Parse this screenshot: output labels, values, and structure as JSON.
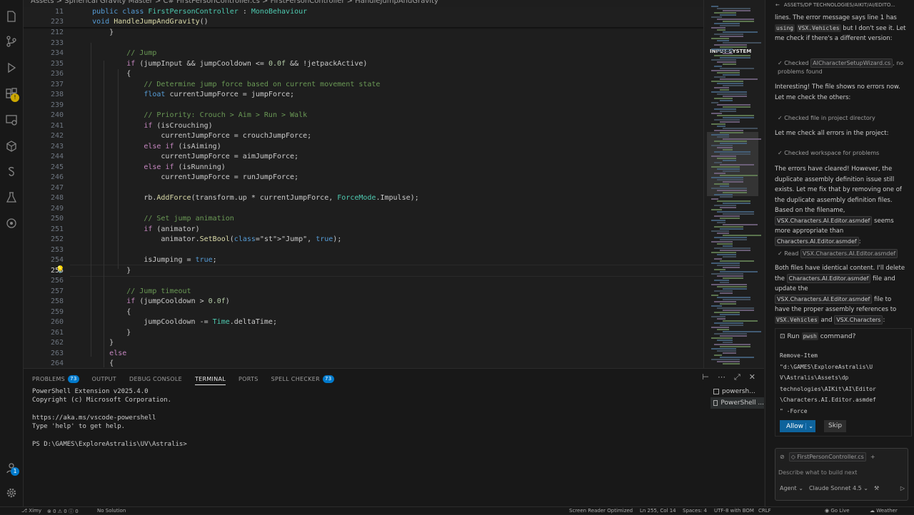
{
  "breadcrumb": "Assets > Spherical Gravity Master > C# FirstPersonController.cs > FirstPersonController > HandleJumpAndGravity",
  "sticky_lines": [
    {
      "num": "11",
      "text": "    public class FirstPersonController : MonoBehaviour"
    },
    {
      "num": "223",
      "text": "    void HandleJumpAndGravity()"
    }
  ],
  "code_lines": [
    {
      "num": "212",
      "text": "        }"
    },
    {
      "num": "233",
      "text": ""
    },
    {
      "num": "234",
      "text": "            // Jump"
    },
    {
      "num": "235",
      "text": "            if (jumpInput && jumpCooldown <= 0.0f && !jetpackActive)"
    },
    {
      "num": "236",
      "text": "            {"
    },
    {
      "num": "237",
      "text": "                // Determine jump force based on current movement state"
    },
    {
      "num": "238",
      "text": "                float currentJumpForce = jumpForce;"
    },
    {
      "num": "239",
      "text": ""
    },
    {
      "num": "240",
      "text": "                // Priority: Crouch > Aim > Run > Walk"
    },
    {
      "num": "241",
      "text": "                if (isCrouching)"
    },
    {
      "num": "242",
      "text": "                    currentJumpForce = crouchJumpForce;"
    },
    {
      "num": "243",
      "text": "                else if (isAiming)"
    },
    {
      "num": "244",
      "text": "                    currentJumpForce = aimJumpForce;"
    },
    {
      "num": "245",
      "text": "                else if (isRunning)"
    },
    {
      "num": "246",
      "text": "                    currentJumpForce = runJumpForce;"
    },
    {
      "num": "247",
      "text": ""
    },
    {
      "num": "248",
      "text": "                rb.AddForce(transform.up * currentJumpForce, ForceMode.Impulse);"
    },
    {
      "num": "249",
      "text": ""
    },
    {
      "num": "250",
      "text": "                // Set jump animation"
    },
    {
      "num": "251",
      "text": "                if (animator)"
    },
    {
      "num": "252",
      "text": "                    animator.SetBool(\"Jump\", true);"
    },
    {
      "num": "253",
      "text": ""
    },
    {
      "num": "254",
      "text": "                isJumping = true;"
    },
    {
      "num": "255",
      "text": "            }"
    },
    {
      "num": "256",
      "text": ""
    },
    {
      "num": "257",
      "text": "            // Jump timeout"
    },
    {
      "num": "258",
      "text": "            if (jumpCooldown > 0.0f)"
    },
    {
      "num": "259",
      "text": "            {"
    },
    {
      "num": "260",
      "text": "                jumpCooldown -= Time.deltaTime;"
    },
    {
      "num": "261",
      "text": "            }"
    },
    {
      "num": "262",
      "text": "        }"
    },
    {
      "num": "263",
      "text": "        else"
    },
    {
      "num": "264",
      "text": "        {"
    }
  ],
  "minimap": {
    "label": "INPUT SYSTEM"
  },
  "panel": {
    "tabs": [
      {
        "label": "PROBLEMS",
        "count": "73"
      },
      {
        "label": "OUTPUT",
        "count": ""
      },
      {
        "label": "DEBUG CONSOLE",
        "count": ""
      },
      {
        "label": "TERMINAL",
        "count": ""
      },
      {
        "label": "PORTS",
        "count": ""
      },
      {
        "label": "SPELL CHECKER",
        "count": "73"
      }
    ],
    "active_tab": "TERMINAL",
    "terminal_lines": [
      "PowerShell Extension v2025.4.0",
      "Copyright (c) Microsoft Corporation.",
      "",
      "https://aka.ms/vscode-powershell",
      "Type 'help' to get help.",
      "",
      "PS D:\\GAMES\\ExploreAstralis\\UV\\Astralis>"
    ],
    "terminals": [
      "powersh...",
      "PowerShell ..."
    ]
  },
  "chat": {
    "header": "ASSETS/DP TECHNOLOGIES/AIKIT/AI/EDITO...",
    "p1_text": "lines. The error message says line 1 has",
    "p1_code": "using",
    "p1_code2": "VSX.Vehicles",
    "p1_rest": "but I don't see it. Let me check if there's a different version:",
    "check1_prefix": "Checked",
    "check1_file": "AICharacterSetupWizard.cs",
    "check1_suffix": ", no problems found",
    "p2": "Interesting! The file shows no errors now. Let me check the others:",
    "check2": "Checked file in project directory",
    "p3": "Let me check all errors in the project:",
    "check3": "Checked workspace for problems",
    "p4": "The errors have cleared! However, the duplicate assembly definition issue still exists. Let me fix that by removing one of the duplicate assembly definition files. Based on the filename,",
    "p4_file1": "VSX.Characters.AI.Editor.asmdef",
    "p4_mid": "seems more appropriate than",
    "p4_file2": "Characters.AI.Editor.asmdef",
    "check4_prefix": "Read",
    "check4_file": "VSX.Characters.AI.Editor.asmdef",
    "p5_a": "Both files have identical content. I'll delete the",
    "p5_file1": "Characters.AI.Editor.asmdef",
    "p5_b": "file and update the",
    "p5_file2": "VSX.Characters.AI.Editor.asmdef",
    "p5_c": "file to have the proper assembly references to",
    "p5_code1": "VSX.Vehicles",
    "p5_and": "and",
    "p5_code2": "VSX.Characters",
    "run_label": "Run",
    "run_shell": "pwsh",
    "run_suffix": "command?",
    "run_command": "Remove-Item\n\"d:\\GAMES\\ExploreAstralis\\U\nV\\Astralis\\Assets\\dp\ntechnologies\\AIKit\\AI\\Editor\n\\Characters.AI.Editor.asmdef\n\" -Force",
    "allow_label": "Allow",
    "skip_label": "Skip",
    "context_file": "FirstPersonController.cs",
    "input_placeholder": "Describe what to build next",
    "mode": "Agent",
    "model": "Claude Sonnet 4.5"
  },
  "status": {
    "branch": "Ximy",
    "errors": "0",
    "warnings": "0",
    "info": "0",
    "solution": "No Solution",
    "screen_reader": "Screen Reader Optimized",
    "position": "Ln 255, Col 14",
    "spaces": "Spaces: 4",
    "encoding": "UTF-8 with BOM",
    "eol": "CRLF",
    "golive": "Go Live",
    "weather": "Weather"
  }
}
